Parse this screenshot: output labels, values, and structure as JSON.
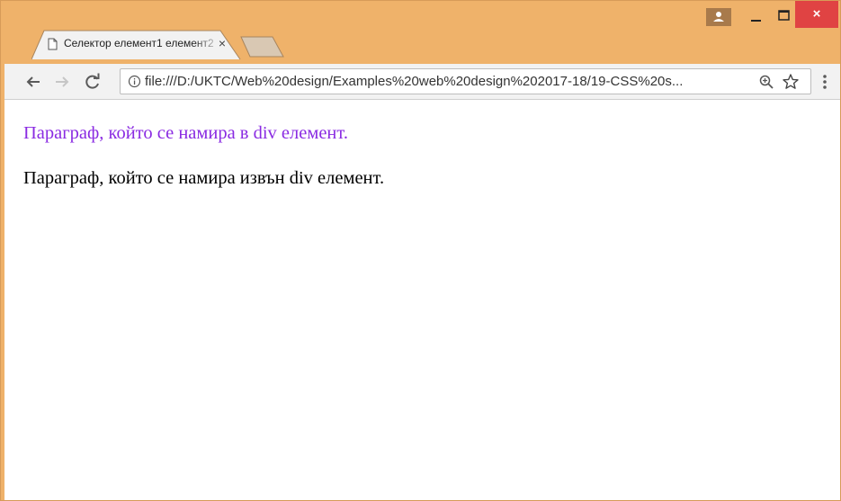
{
  "window": {
    "close_label": "×"
  },
  "tab": {
    "title": "Селектор елемент1 елемент2",
    "close_label": "×"
  },
  "toolbar": {
    "url": "file:///D:/UKTC/Web%20design/Examples%20web%20design%202017-18/19-CSS%20s..."
  },
  "page": {
    "paragraph_in_div": "Параграф, който се намира в div елемент.",
    "paragraph_outside_div": "Параграф, който се намира извън div елемент."
  },
  "colors": {
    "frame": "#efb26a",
    "close_button": "#e04343",
    "div_paragraph": "#8a2be2",
    "body_text": "#000000"
  },
  "icons": {
    "tab_favicon": "page-icon",
    "back": "arrow-left-icon",
    "forward": "arrow-right-icon",
    "reload": "reload-icon",
    "info": "info-icon",
    "zoom": "zoom-icon",
    "bookmark": "star-icon",
    "menu": "kebab-menu-icon",
    "profile": "user-icon"
  }
}
